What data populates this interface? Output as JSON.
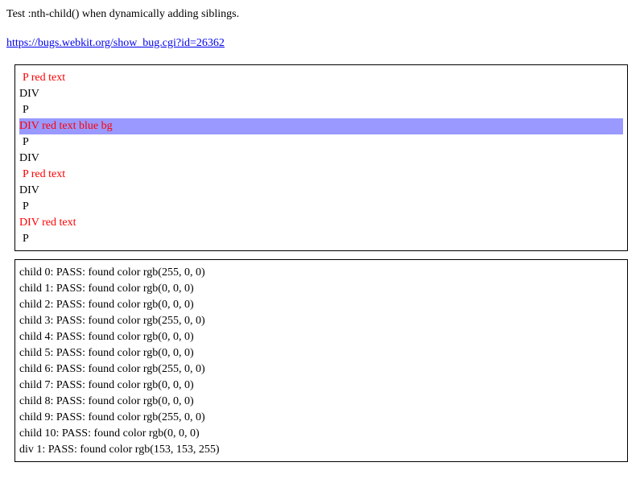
{
  "header": {
    "intro_text": "Test :nth-child() when dynamically adding siblings.",
    "bug_link_text": "https://bugs.webkit.org/show_bug.cgi?id=26362"
  },
  "colors": {
    "red_text": "#ff0000",
    "blue_bg": "#9999ff",
    "link": "#0000ee"
  },
  "test_box": {
    "rows": [
      {
        "text": "P red text",
        "type": "p",
        "red": true,
        "blue_bg": false
      },
      {
        "text": "DIV",
        "type": "div",
        "red": false,
        "blue_bg": false
      },
      {
        "text": "P",
        "type": "p",
        "red": false,
        "blue_bg": false
      },
      {
        "text": "DIV red text blue bg",
        "type": "div",
        "red": true,
        "blue_bg": true
      },
      {
        "text": "P",
        "type": "p",
        "red": false,
        "blue_bg": false
      },
      {
        "text": "DIV",
        "type": "div",
        "red": false,
        "blue_bg": false
      },
      {
        "text": "P red text",
        "type": "p",
        "red": true,
        "blue_bg": false
      },
      {
        "text": "DIV",
        "type": "div",
        "red": false,
        "blue_bg": false
      },
      {
        "text": "P",
        "type": "p",
        "red": false,
        "blue_bg": false
      },
      {
        "text": "DIV red text",
        "type": "div",
        "red": true,
        "blue_bg": false
      },
      {
        "text": "P",
        "type": "p",
        "red": false,
        "blue_bg": false
      }
    ]
  },
  "results": [
    "child 0: PASS: found color rgb(255, 0, 0)",
    "child 1: PASS: found color rgb(0, 0, 0)",
    "child 2: PASS: found color rgb(0, 0, 0)",
    "child 3: PASS: found color rgb(255, 0, 0)",
    "child 4: PASS: found color rgb(0, 0, 0)",
    "child 5: PASS: found color rgb(0, 0, 0)",
    "child 6: PASS: found color rgb(255, 0, 0)",
    "child 7: PASS: found color rgb(0, 0, 0)",
    "child 8: PASS: found color rgb(0, 0, 0)",
    "child 9: PASS: found color rgb(255, 0, 0)",
    "child 10: PASS: found color rgb(0, 0, 0)",
    "div 1: PASS: found color rgb(153, 153, 255)"
  ]
}
